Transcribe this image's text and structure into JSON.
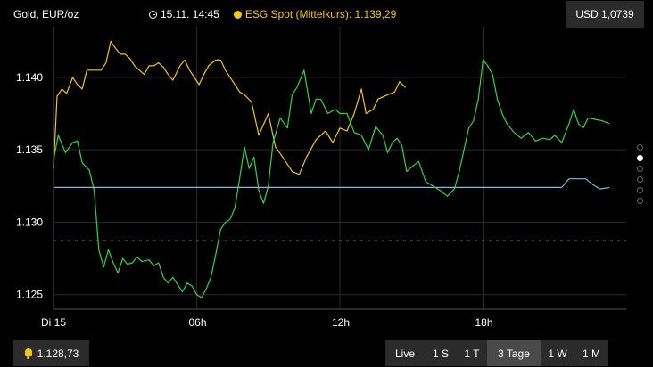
{
  "header": {
    "instrument": "Gold, EUR/oz",
    "timestamp": "15.11. 14:45",
    "spot_label": "ESG Spot (Mittelkurs): 1.139,29",
    "fx_rate": "USD 1,0739"
  },
  "footer": {
    "alert_value": "1.128,73",
    "tabs": [
      {
        "label": "Live",
        "active": false
      },
      {
        "label": "1 S",
        "active": false
      },
      {
        "label": "1 T",
        "active": false
      },
      {
        "label": "3 Tage",
        "active": true
      },
      {
        "label": "1 W",
        "active": false
      },
      {
        "label": "1 M",
        "active": false
      }
    ]
  },
  "pager": {
    "count": 6,
    "active": 1
  },
  "colors": {
    "yellow_series": "#f5c518",
    "green_series": "#33d63c",
    "blue_line": "#7fb6e6",
    "dashed_line": "#a89a2e",
    "grid": "#2a2a2a",
    "background": "#000000"
  },
  "chart_data": {
    "type": "line",
    "x_range": [
      0,
      24
    ],
    "ylim": [
      1.124,
      1.1435
    ],
    "y_ticks": [
      {
        "value": 1.14,
        "label": "1.140"
      },
      {
        "value": 1.135,
        "label": "1.135"
      },
      {
        "value": 1.13,
        "label": "1.130"
      },
      {
        "value": 1.125,
        "label": "1.125"
      }
    ],
    "x_ticks": [
      {
        "value": 0,
        "label": "Di 15"
      },
      {
        "value": 6,
        "label": "06h"
      },
      {
        "value": 12,
        "label": "12h"
      },
      {
        "value": 18,
        "label": "18h"
      }
    ],
    "series": [
      {
        "color_key": "yellow_series",
        "points": [
          [
            0,
            1.1337
          ],
          [
            0.15,
            1.1387
          ],
          [
            0.35,
            1.1392
          ],
          [
            0.55,
            1.1389
          ],
          [
            0.8,
            1.14
          ],
          [
            1.0,
            1.1395
          ],
          [
            1.2,
            1.1392
          ],
          [
            1.4,
            1.1405
          ],
          [
            1.7,
            1.1405
          ],
          [
            2.0,
            1.1405
          ],
          [
            2.2,
            1.141
          ],
          [
            2.4,
            1.1425
          ],
          [
            2.6,
            1.142
          ],
          [
            2.8,
            1.1416
          ],
          [
            3.0,
            1.1416
          ],
          [
            3.2,
            1.1413
          ],
          [
            3.4,
            1.1408
          ],
          [
            3.6,
            1.1405
          ],
          [
            3.8,
            1.1402
          ],
          [
            4.0,
            1.1408
          ],
          [
            4.2,
            1.1408
          ],
          [
            4.4,
            1.141
          ],
          [
            4.6,
            1.1407
          ],
          [
            4.8,
            1.1402
          ],
          [
            5.0,
            1.1398
          ],
          [
            5.3,
            1.1408
          ],
          [
            5.5,
            1.1412
          ],
          [
            5.7,
            1.1405
          ],
          [
            5.9,
            1.14
          ],
          [
            6.1,
            1.1395
          ],
          [
            6.3,
            1.1402
          ],
          [
            6.5,
            1.1408
          ],
          [
            6.8,
            1.1412
          ],
          [
            7.0,
            1.1412
          ],
          [
            7.2,
            1.1405
          ],
          [
            7.4,
            1.14
          ],
          [
            7.6,
            1.1395
          ],
          [
            7.8,
            1.139
          ],
          [
            8.0,
            1.1388
          ],
          [
            8.3,
            1.1383
          ],
          [
            8.6,
            1.136
          ],
          [
            9.0,
            1.1375
          ],
          [
            9.3,
            1.1352
          ],
          [
            9.6,
            1.1345
          ],
          [
            10.0,
            1.1335
          ],
          [
            10.3,
            1.1333
          ],
          [
            10.6,
            1.1345
          ],
          [
            11.0,
            1.1357
          ],
          [
            11.4,
            1.1363
          ],
          [
            11.7,
            1.1355
          ],
          [
            12.0,
            1.1365
          ],
          [
            12.3,
            1.1363
          ],
          [
            12.6,
            1.1375
          ],
          [
            12.9,
            1.1392
          ],
          [
            13.1,
            1.1375
          ],
          [
            13.4,
            1.1378
          ],
          [
            13.6,
            1.1385
          ],
          [
            14.0,
            1.1388
          ],
          [
            14.3,
            1.139
          ],
          [
            14.5,
            1.1397
          ],
          [
            14.75,
            1.1393
          ]
        ]
      },
      {
        "color_key": "green_series",
        "points": [
          [
            0,
            1.1343
          ],
          [
            0.2,
            1.136
          ],
          [
            0.5,
            1.1348
          ],
          [
            0.8,
            1.1355
          ],
          [
            1.0,
            1.1356
          ],
          [
            1.2,
            1.1341
          ],
          [
            1.5,
            1.1336
          ],
          [
            1.7,
            1.1322
          ],
          [
            1.9,
            1.1281
          ],
          [
            2.1,
            1.1269
          ],
          [
            2.3,
            1.1281
          ],
          [
            2.5,
            1.1272
          ],
          [
            2.7,
            1.1265
          ],
          [
            2.9,
            1.1275
          ],
          [
            3.1,
            1.1271
          ],
          [
            3.3,
            1.1272
          ],
          [
            3.5,
            1.1276
          ],
          [
            3.7,
            1.1273
          ],
          [
            4.0,
            1.1274
          ],
          [
            4.2,
            1.127
          ],
          [
            4.4,
            1.1272
          ],
          [
            4.6,
            1.1262
          ],
          [
            4.8,
            1.1258
          ],
          [
            5.0,
            1.1262
          ],
          [
            5.2,
            1.1257
          ],
          [
            5.4,
            1.1252
          ],
          [
            5.6,
            1.1258
          ],
          [
            5.8,
            1.1256
          ],
          [
            6.0,
            1.125
          ],
          [
            6.2,
            1.1248
          ],
          [
            6.4,
            1.1254
          ],
          [
            6.6,
            1.1262
          ],
          [
            6.8,
            1.1278
          ],
          [
            7.0,
            1.1295
          ],
          [
            7.2,
            1.13
          ],
          [
            7.4,
            1.1302
          ],
          [
            7.6,
            1.131
          ],
          [
            7.8,
            1.133
          ],
          [
            8.0,
            1.1352
          ],
          [
            8.2,
            1.1337
          ],
          [
            8.4,
            1.1345
          ],
          [
            8.6,
            1.1322
          ],
          [
            8.8,
            1.1313
          ],
          [
            9.0,
            1.1325
          ],
          [
            9.2,
            1.1355
          ],
          [
            9.5,
            1.1372
          ],
          [
            9.8,
            1.1365
          ],
          [
            10.0,
            1.1388
          ],
          [
            10.2,
            1.1393
          ],
          [
            10.5,
            1.1405
          ],
          [
            10.8,
            1.1375
          ],
          [
            11.0,
            1.1385
          ],
          [
            11.2,
            1.1385
          ],
          [
            11.5,
            1.1375
          ],
          [
            11.8,
            1.1378
          ],
          [
            12.0,
            1.1375
          ],
          [
            12.3,
            1.1375
          ],
          [
            12.6,
            1.1362
          ],
          [
            12.9,
            1.136
          ],
          [
            13.2,
            1.135
          ],
          [
            13.5,
            1.1366
          ],
          [
            13.8,
            1.136
          ],
          [
            14.0,
            1.1348
          ],
          [
            14.2,
            1.1355
          ],
          [
            14.4,
            1.1358
          ],
          [
            14.6,
            1.1353
          ],
          [
            14.8,
            1.1335
          ],
          [
            15.0,
            1.1338
          ],
          [
            15.3,
            1.1342
          ],
          [
            15.6,
            1.1328
          ],
          [
            15.9,
            1.1325
          ],
          [
            16.2,
            1.1322
          ],
          [
            16.5,
            1.1318
          ],
          [
            16.8,
            1.1323
          ],
          [
            17.0,
            1.1335
          ],
          [
            17.2,
            1.135
          ],
          [
            17.4,
            1.1365
          ],
          [
            17.6,
            1.137
          ],
          [
            17.8,
            1.1385
          ],
          [
            18.0,
            1.1412
          ],
          [
            18.2,
            1.1408
          ],
          [
            18.4,
            1.1402
          ],
          [
            18.6,
            1.1385
          ],
          [
            18.8,
            1.1375
          ],
          [
            19.0,
            1.1368
          ],
          [
            19.3,
            1.1362
          ],
          [
            19.6,
            1.1358
          ],
          [
            19.9,
            1.1362
          ],
          [
            20.2,
            1.1356
          ],
          [
            20.5,
            1.1358
          ],
          [
            20.8,
            1.1357
          ],
          [
            21.0,
            1.136
          ],
          [
            21.3,
            1.1355
          ],
          [
            21.6,
            1.1368
          ],
          [
            21.8,
            1.1378
          ],
          [
            22.0,
            1.1368
          ],
          [
            22.2,
            1.1365
          ],
          [
            22.4,
            1.1372
          ],
          [
            22.7,
            1.1371
          ],
          [
            23.0,
            1.137
          ],
          [
            23.3,
            1.1368
          ]
        ]
      },
      {
        "color_key": "blue_line",
        "points": [
          [
            0,
            1.1324
          ],
          [
            21.3,
            1.1324
          ],
          [
            21.6,
            1.133
          ],
          [
            22.0,
            1.133
          ],
          [
            22.3,
            1.133
          ],
          [
            22.6,
            1.1326
          ],
          [
            22.9,
            1.1323
          ],
          [
            23.3,
            1.1324
          ]
        ]
      }
    ],
    "reference_level": 1.12873
  }
}
